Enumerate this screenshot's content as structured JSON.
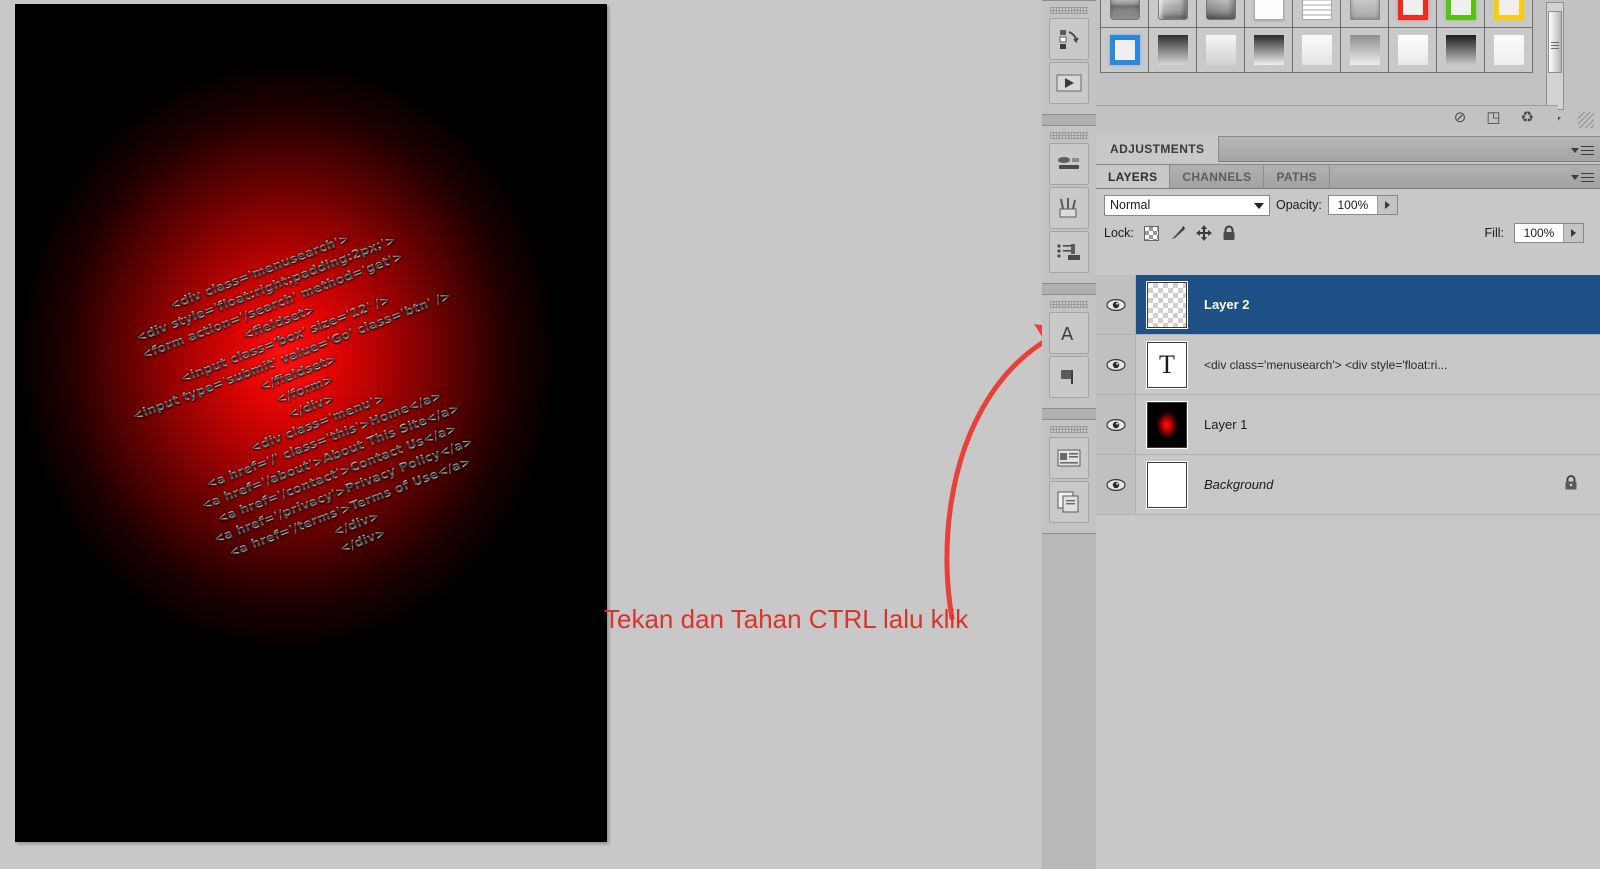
{
  "app": {
    "name": "Adobe Photoshop",
    "workspace_bg": "#c8c8c8"
  },
  "canvas": {
    "name": "document-canvas",
    "background_color": "#000000",
    "glow_color": "#ff1010",
    "code_lines": [
      "<div class='menusearch'>",
      "<div style='float:right;padding:2px;'>",
      "<form action='/search' method='get'>",
      "<fieldset>",
      "<input class='box' size='12' />",
      "<input type='submit' value='Go' class='btn' />",
      "</fieldset>",
      "</form>",
      "</div>",
      "<div class='menu'>",
      "<a href='/' class='this'>Home</a>",
      "<a href='/about'>About This Site</a>",
      "<a href='/contact'>Contact Us</a>",
      "<a href='/privacy'>Privacy Policy</a>",
      "<a href='/terms'>Terms of Use</a>",
      "</div>",
      "</div>"
    ]
  },
  "annotation": {
    "text": "Tekan dan Tahan CTRL lalu klik",
    "color": "#d9342b",
    "arrow_color": "#e8413a"
  },
  "icon_dock": {
    "groups": [
      {
        "items": [
          {
            "name": "history-panel-icon",
            "label": "History"
          },
          {
            "name": "actions-panel-icon",
            "label": "Actions"
          }
        ]
      },
      {
        "items": [
          {
            "name": "color-panel-icon",
            "label": "Color"
          },
          {
            "name": "brushes-panel-icon",
            "label": "Brushes"
          },
          {
            "name": "clone-source-panel-icon",
            "label": "Clone Source"
          }
        ]
      },
      {
        "items": [
          {
            "name": "character-panel-icon",
            "label": "Character"
          },
          {
            "name": "paragraph-panel-icon",
            "label": "Paragraph"
          }
        ]
      },
      {
        "items": [
          {
            "name": "info-panel-icon",
            "label": "Info"
          },
          {
            "name": "layer-comps-panel-icon",
            "label": "Layer Comps"
          }
        ]
      }
    ]
  },
  "styles_panel": {
    "name": "styles-panel",
    "swatches_row1": [
      {
        "name": "style-bevel-down",
        "kind": "bevel-down"
      },
      {
        "name": "style-bevel-soft",
        "kind": "bevel-soft"
      },
      {
        "name": "style-bevel-curl",
        "kind": "bevel-curl"
      },
      {
        "name": "style-plain-white",
        "kind": "plain-white"
      },
      {
        "name": "style-lined",
        "kind": "lined"
      },
      {
        "name": "style-gray-emboss",
        "kind": "gray-emboss"
      },
      {
        "name": "style-red-frame",
        "kind": "frame",
        "color": "#ee2b22"
      },
      {
        "name": "style-green-frame",
        "kind": "frame",
        "color": "#56c410"
      },
      {
        "name": "style-yellow-frame",
        "kind": "frame",
        "color": "#f2cf12"
      }
    ],
    "swatches_row2": [
      {
        "name": "style-blue-frame",
        "kind": "frame",
        "color": "#2a86df"
      },
      {
        "name": "style-gradient-dark",
        "kind": "grad-dark"
      },
      {
        "name": "style-gradient-light",
        "kind": "grad-light"
      },
      {
        "name": "style-gradient-steep",
        "kind": "grad-steep"
      },
      {
        "name": "style-gradient-pale",
        "kind": "grad-pale"
      },
      {
        "name": "style-gradient-mid",
        "kind": "grad-mid"
      },
      {
        "name": "style-gradient-white",
        "kind": "grad-white"
      },
      {
        "name": "style-gradient-black",
        "kind": "grad-black"
      },
      {
        "name": "style-gradient-faint",
        "kind": "grad-faint"
      }
    ],
    "footer_buttons": [
      {
        "name": "clear-style-button",
        "glyph": "⊘"
      },
      {
        "name": "new-style-button",
        "glyph": "◳"
      },
      {
        "name": "delete-style-button",
        "glyph": "♻"
      }
    ],
    "scrollbar": {
      "name": "styles-scrollbar"
    }
  },
  "adjustments_panel": {
    "tab_label": "ADJUSTMENTS"
  },
  "layers_panel": {
    "tabs": [
      {
        "label": "LAYERS",
        "active": true
      },
      {
        "label": "CHANNELS",
        "active": false
      },
      {
        "label": "PATHS",
        "active": false
      }
    ],
    "blend_mode": "Normal",
    "opacity_label": "Opacity:",
    "opacity_value": "100%",
    "lock_label": "Lock:",
    "fill_label": "Fill:",
    "fill_value": "100%",
    "lock_icons": [
      {
        "name": "lock-transparent-pixels-icon"
      },
      {
        "name": "lock-image-pixels-icon"
      },
      {
        "name": "lock-position-icon"
      },
      {
        "name": "lock-all-icon"
      }
    ],
    "layers": [
      {
        "name": "Layer 2",
        "selected": true,
        "visible": true,
        "thumb": "transparent",
        "locked": false,
        "italic": false
      },
      {
        "name": "<div class='menusearch'>  <div style='float:ri...",
        "selected": false,
        "visible": true,
        "thumb": "text",
        "thumb_glyph": "T",
        "locked": false,
        "italic": false
      },
      {
        "name": "Layer 1",
        "selected": false,
        "visible": true,
        "thumb": "redglow",
        "locked": false,
        "italic": false
      },
      {
        "name": "Background",
        "selected": false,
        "visible": true,
        "thumb": "white",
        "locked": true,
        "italic": true
      }
    ],
    "selected_highlight_color": "#1e4f85"
  }
}
